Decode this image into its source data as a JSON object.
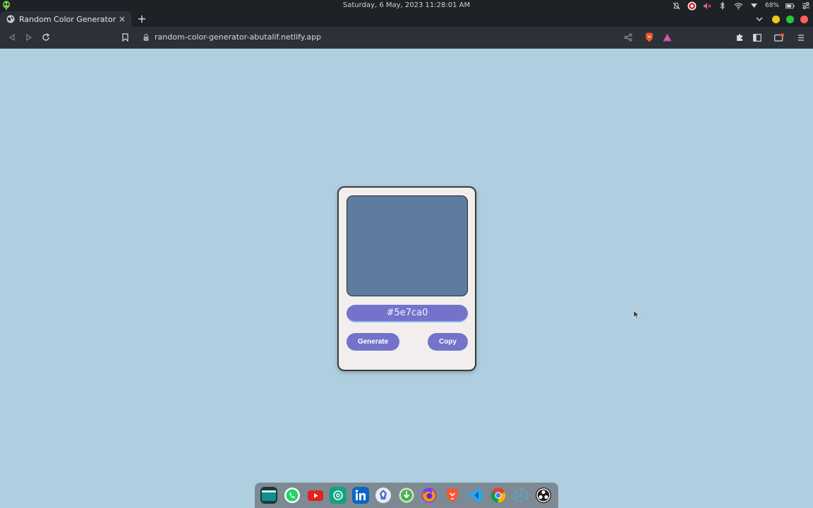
{
  "system_bar": {
    "datetime": "Saturday, 6 May, 2023  11:28:01 AM",
    "battery_percent": "68%",
    "icons": [
      "app-launcher-icon",
      "notifications-muted-icon",
      "obs-icon",
      "volume-muted-icon",
      "bluetooth-icon",
      "wifi-icon",
      "battery-icon",
      "settings-icon"
    ]
  },
  "browser": {
    "tab_title": "Random Color Generator",
    "tab_close": "×",
    "new_tab": "+",
    "url": "random-color-generator-abutalif.netlify.app",
    "window_controls_colors": [
      "#f5c518",
      "#27c93f",
      "#ff5f57"
    ],
    "toolbar_icons": [
      "back-icon",
      "forward-icon",
      "reload-icon",
      "bookmark-icon",
      "share-icon",
      "brave-shields-icon",
      "brave-rewards-icon",
      "extensions-icon",
      "sidebar-icon",
      "wallet-icon",
      "menu-icon"
    ]
  },
  "app": {
    "current_color": "#5e7ca0",
    "hex_value": "#5e7ca0",
    "generate_label": "Generate",
    "copy_label": "Copy",
    "accent_color": "#7373cc",
    "page_background": "#afcfe0"
  },
  "dock": {
    "apps": [
      "files-icon",
      "whatsapp-icon",
      "youtube-icon",
      "chatgpt-icon",
      "linkedin-icon",
      "zorin-icon",
      "downloader-icon",
      "firefox-icon",
      "brave-icon",
      "vscode-icon",
      "chrome-icon",
      "network-icon",
      "obs-studio-icon"
    ]
  }
}
